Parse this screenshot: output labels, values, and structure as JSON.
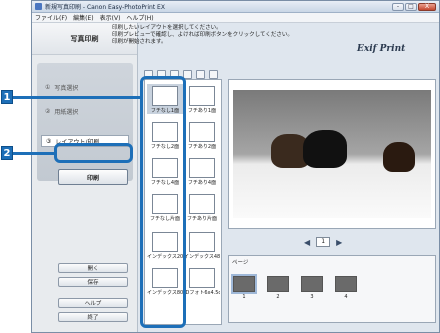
{
  "window": {
    "title": "新規写真印刷 - Canon Easy-PhotoPrint EX",
    "buttons": [
      "-",
      "□",
      "X"
    ]
  },
  "menu": [
    "ファイル(F)",
    "編集(E)",
    "表示(V)",
    "ヘルプ(H)"
  ],
  "left_panel": {
    "title": "写真印刷",
    "steps": [
      {
        "num": "①",
        "label": "写真選択"
      },
      {
        "num": "②",
        "label": "用紙選択"
      },
      {
        "num": "③",
        "label": "レイアウト/印刷"
      }
    ],
    "print_button": "印刷",
    "bottom_buttons": [
      "開く",
      "保存",
      "ヘルプ",
      "終了"
    ]
  },
  "instructions": [
    "印刷したいレイアウトを選択してください。",
    "印刷プレビューで確認し、よければ印刷ボタンをクリックしてください。",
    "印刷が開始されます。"
  ],
  "logo": "Exif Print",
  "layouts": [
    {
      "caption": "フチなし1面"
    },
    {
      "caption": "フチあり1面"
    },
    {
      "caption": "フチなし2面"
    },
    {
      "caption": "フチあり2面"
    },
    {
      "caption": "フチなし4面"
    },
    {
      "caption": "フチあり4面"
    },
    {
      "caption": "フチなし片面"
    },
    {
      "caption": "フチあり片面"
    },
    {
      "caption": "インデックス20"
    },
    {
      "caption": "インデックス48"
    },
    {
      "caption": "インデックス80"
    },
    {
      "caption": "IDフォト6x4.5cm"
    }
  ],
  "pager": {
    "page": "1"
  },
  "page_strip": {
    "label": "ページ",
    "numbers": [
      "1",
      "2",
      "3",
      "4"
    ]
  },
  "callouts": [
    "1",
    "2"
  ]
}
